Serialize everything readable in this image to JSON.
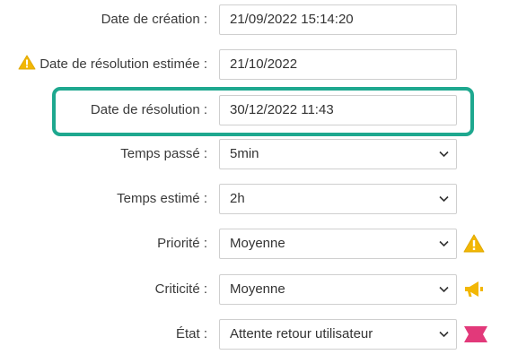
{
  "fields": {
    "creation_date": {
      "label": "Date de création :",
      "value": "21/09/2022 15:14:20"
    },
    "estimated_resolution_date": {
      "label": "Date de résolution estimée :",
      "value": "21/10/2022"
    },
    "resolution_date": {
      "label": "Date de résolution :",
      "value": "30/12/2022 11:43"
    },
    "time_spent": {
      "label": "Temps passé :",
      "value": "5min"
    },
    "time_estimated": {
      "label": "Temps estimé :",
      "value": "2h"
    },
    "priority": {
      "label": "Priorité :",
      "value": "Moyenne"
    },
    "criticality": {
      "label": "Criticité :",
      "value": "Moyenne"
    },
    "state": {
      "label": "État :",
      "value": "Attente retour utilisateur"
    }
  },
  "icons": {
    "warning": "warning-triangle-icon",
    "megaphone": "megaphone-icon",
    "ribbon": "ribbon-icon",
    "chevron": "chevron-down-icon"
  },
  "colors": {
    "highlight": "#1ea88f",
    "warning": "#f2b705",
    "megaphone": "#f2b705",
    "ribbon": "#e2397a"
  }
}
